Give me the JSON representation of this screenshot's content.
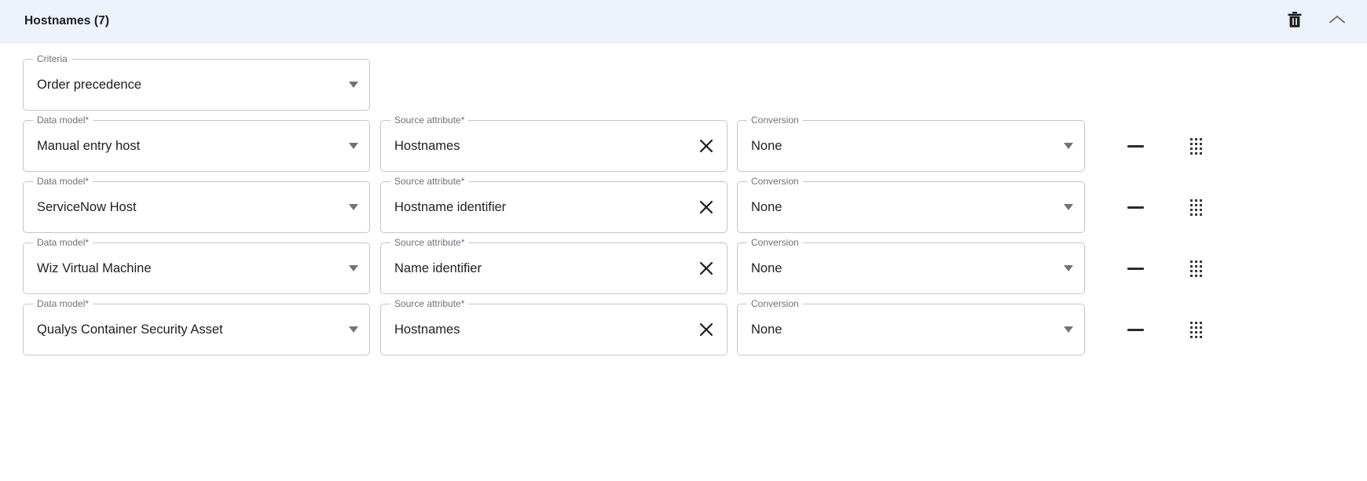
{
  "panel": {
    "title": "Hostnames (7)",
    "header_bg": "#eef2fb",
    "delete_icon": "trash-icon",
    "collapse_icon": "chevron-up-icon"
  },
  "criteria": {
    "label": "Criteria",
    "value": "Order precedence",
    "caret_icon": "chevron-down-icon"
  },
  "column_labels": {
    "data_model": "Data model*",
    "source_attribute": "Source attribute*",
    "conversion": "Conversion"
  },
  "row_controls": {
    "remove_icon": "minus-icon",
    "drag_icon": "drag-handle-icon",
    "clear_icon": "close-icon"
  },
  "mappings": [
    {
      "data_model": "Manual entry host",
      "source_attribute": "Hostnames",
      "conversion": "None"
    },
    {
      "data_model": "ServiceNow Host",
      "source_attribute": "Hostname identifier",
      "conversion": "None"
    },
    {
      "data_model": "Wiz Virtual Machine",
      "source_attribute": "Name identifier",
      "conversion": "None"
    },
    {
      "data_model": "Qualys Container Security Asset",
      "source_attribute": "Hostnames",
      "conversion": "None"
    }
  ]
}
